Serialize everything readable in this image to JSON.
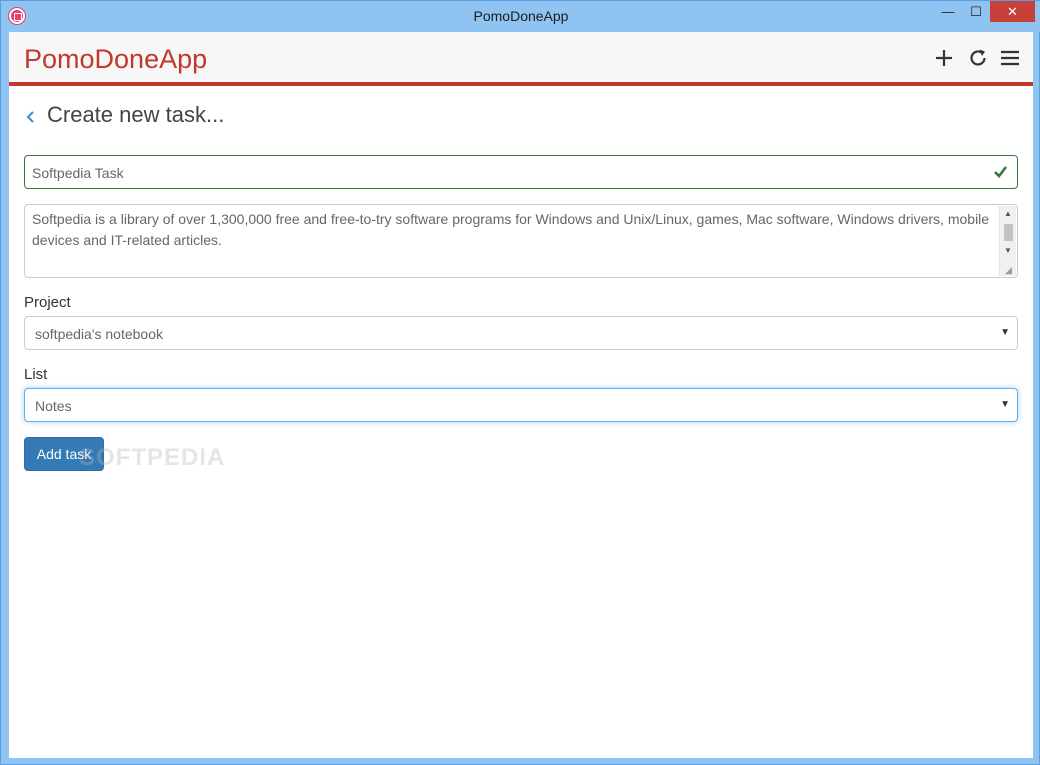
{
  "window": {
    "title": "PomoDoneApp",
    "minimize_glyph": "—",
    "maximize_glyph": "☐",
    "close_glyph": "✕"
  },
  "header": {
    "logo": "PomoDoneApp",
    "icons": [
      "plus-icon",
      "refresh-icon",
      "hamburger-menu-icon"
    ]
  },
  "page": {
    "title": "Create new task..."
  },
  "form": {
    "task_name": "Softpedia Task",
    "description": "Softpedia is a library of over 1,300,000 free and free-to-try software programs for Windows and Unix/Linux, games, Mac software, Windows drivers, mobile devices and IT-related articles.\n\nWe review and categorize these products in order to allow the visitor/user to find the exact product they and their system needs.",
    "project_label": "Project",
    "project_value": "softpedia's notebook",
    "list_label": "List",
    "list_value": "Notes",
    "submit_label": "Add task"
  },
  "watermark": "SOFTPEDIA",
  "colors": {
    "brand": "#c0392b",
    "primary_button": "#337ab7",
    "valid_border": "#3c763d",
    "focus_border": "#66afe9"
  }
}
